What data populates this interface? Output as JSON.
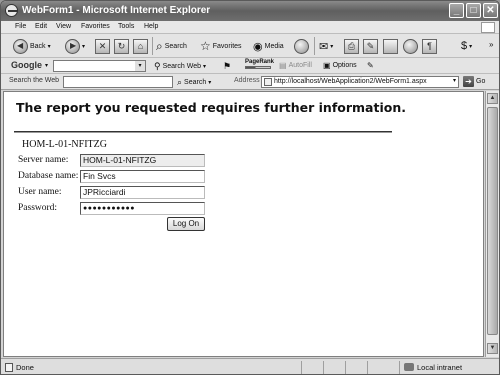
{
  "window": {
    "title": "WebForm1 - Microsoft Internet Explorer"
  },
  "menu": [
    "File",
    "Edit",
    "View",
    "Favorites",
    "Tools",
    "Help"
  ],
  "toolbar": {
    "back": "Back",
    "search": "Search",
    "favorites": "Favorites",
    "media": "Media"
  },
  "google_bar": {
    "logo": "Google",
    "search_web": "Search Web",
    "pagerank": "PageRank",
    "autofill": "AutoFill",
    "options": "Options"
  },
  "address_bar": {
    "search_the_web": "Search the Web",
    "search_button": "Search",
    "address_label": "Address",
    "url": "http://localhost/WebApplication2/WebForm1.aspx",
    "go": "Go"
  },
  "page": {
    "heading": "The report you requested requires further information.",
    "server_caption": "HOM-L-01-NFITZG",
    "fields": {
      "server": {
        "label": "Server name:",
        "value": "HOM-L-01-NFITZG"
      },
      "database": {
        "label": "Database name:",
        "value": "Fin Svcs"
      },
      "user": {
        "label": "User name:",
        "value": "JPRicciardi"
      },
      "password": {
        "label": "Password:",
        "value": "●●●●●●●●●●●"
      }
    },
    "logon_label": "Log On"
  },
  "status": {
    "text": "Done",
    "zone": "Local intranet"
  }
}
